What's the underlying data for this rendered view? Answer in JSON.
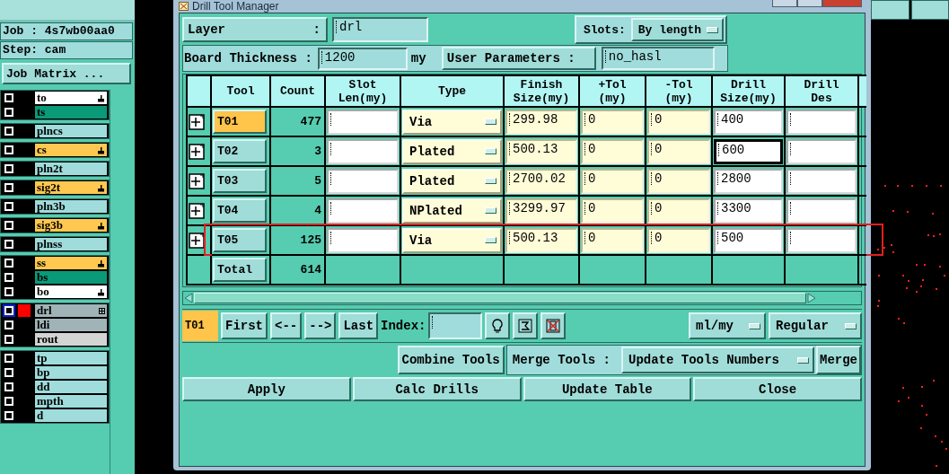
{
  "title_bar": {
    "title": "Drill Tool Manager"
  },
  "job_panel": {
    "job_label": "Job : 4s7wb00aa0",
    "step_label": "Step: cam",
    "matrix_button": "Job Matrix ...",
    "layer_groups": [
      {
        "layers": [
          {
            "name": "to",
            "color": "#ffffff",
            "checked": false,
            "selected": false,
            "hand_mark": true,
            "grid_mark": false
          },
          {
            "name": "ts",
            "color": "#0a9a78",
            "checked": false,
            "selected": false,
            "hand_mark": false,
            "grid_mark": false
          }
        ]
      },
      {
        "layers": [
          {
            "name": "plncs",
            "color": "#a0dcdc",
            "checked": false,
            "selected": false,
            "hand_mark": false,
            "grid_mark": false
          }
        ]
      },
      {
        "layers": [
          {
            "name": "cs",
            "color": "#ffc850",
            "checked": false,
            "selected": false,
            "hand_mark": true,
            "grid_mark": false
          }
        ]
      },
      {
        "layers": [
          {
            "name": "pln2t",
            "color": "#a0dcdc",
            "checked": false,
            "selected": false,
            "hand_mark": false,
            "grid_mark": false
          }
        ]
      },
      {
        "layers": [
          {
            "name": "sig2t",
            "color": "#ffc850",
            "checked": false,
            "selected": false,
            "hand_mark": true,
            "grid_mark": false
          }
        ]
      },
      {
        "layers": [
          {
            "name": "pln3b",
            "color": "#a0dcdc",
            "checked": false,
            "selected": false,
            "hand_mark": false,
            "grid_mark": false
          }
        ]
      },
      {
        "layers": [
          {
            "name": "sig3b",
            "color": "#ffc850",
            "checked": false,
            "selected": false,
            "hand_mark": true,
            "grid_mark": false
          }
        ]
      },
      {
        "layers": [
          {
            "name": "plnss",
            "color": "#a0dcdc",
            "checked": false,
            "selected": false,
            "hand_mark": false,
            "grid_mark": false
          }
        ]
      },
      {
        "layers": [
          {
            "name": "ss",
            "color": "#ffc850",
            "checked": false,
            "selected": false,
            "hand_mark": true,
            "grid_mark": false
          },
          {
            "name": "bs",
            "color": "#0a9a78",
            "checked": false,
            "selected": false,
            "hand_mark": false,
            "grid_mark": false
          },
          {
            "name": "bo",
            "color": "#ffffff",
            "checked": false,
            "selected": false,
            "hand_mark": true,
            "grid_mark": false
          }
        ]
      },
      {
        "layers": [
          {
            "name": "drl",
            "color": "#a0b4b8",
            "checked": false,
            "selected": true,
            "swatch": {
              "color": "#ff0000"
            },
            "hand_mark": false,
            "grid_mark": true
          },
          {
            "name": "ldi",
            "color": "#a0b4b8",
            "checked": false,
            "selected": false,
            "hand_mark": false,
            "grid_mark": false
          },
          {
            "name": "rout",
            "color": "#d4d4d4",
            "checked": false,
            "selected": false,
            "hand_mark": false,
            "grid_mark": false
          }
        ]
      },
      {
        "layers": [
          {
            "name": "tp",
            "color": "#a0dcdc",
            "checked": false,
            "selected": false,
            "hand_mark": false,
            "grid_mark": false
          },
          {
            "name": "bp",
            "color": "#a0dcdc",
            "checked": false,
            "selected": false,
            "hand_mark": false,
            "grid_mark": false
          },
          {
            "name": "dd",
            "color": "#a0dcdc",
            "checked": false,
            "selected": false,
            "hand_mark": false,
            "grid_mark": false
          },
          {
            "name": "mpth",
            "color": "#a0dcdc",
            "checked": false,
            "selected": false,
            "hand_mark": false,
            "grid_mark": false
          },
          {
            "name": "d",
            "color": "#a0dcdc",
            "checked": false,
            "selected": false,
            "hand_mark": false,
            "grid_mark": false
          }
        ]
      }
    ]
  },
  "layer": {
    "label": "Layer",
    "colon": ":",
    "value": "drl"
  },
  "slots": {
    "label": "Slots:",
    "value": "By length"
  },
  "board_thickness": {
    "label": "Board Thickness :",
    "value": "1200",
    "unit": "my"
  },
  "user_parameters": {
    "label": "User Parameters :",
    "value": "no_hasl"
  },
  "table": {
    "columns": [
      "Tool",
      "Count",
      "Slot\nLen(my)",
      "Type",
      "Finish\nSize(my)",
      "+Tol\n(my)",
      "-Tol\n(my)",
      "Drill\nSize(my)",
      "Drill\nDes"
    ],
    "rows": [
      {
        "tool": "T01",
        "selected": true,
        "count": "477",
        "type": "Via",
        "finish": "299.98",
        "plus_tol": "0",
        "minus_tol": "0",
        "drill_size": "400",
        "focused": false,
        "highlighted": false
      },
      {
        "tool": "T02",
        "selected": false,
        "count": "3",
        "type": "Plated",
        "finish": "500.13",
        "plus_tol": "0",
        "minus_tol": "0",
        "drill_size": "600",
        "focused": true,
        "highlighted": false
      },
      {
        "tool": "T03",
        "selected": false,
        "count": "5",
        "type": "Plated",
        "finish": "2700.02",
        "plus_tol": "0",
        "minus_tol": "0",
        "drill_size": "2800",
        "focused": false,
        "highlighted": false
      },
      {
        "tool": "T04",
        "selected": false,
        "count": "4",
        "type": "NPlated",
        "finish": "3299.97",
        "plus_tol": "0",
        "minus_tol": "0",
        "drill_size": "3300",
        "focused": false,
        "highlighted": false
      },
      {
        "tool": "T05",
        "selected": false,
        "count": "125",
        "type": "Via",
        "finish": "500.13",
        "plus_tol": "0",
        "minus_tol": "0",
        "drill_size": "500",
        "focused": false,
        "highlighted": true
      }
    ],
    "total": {
      "label": "Total",
      "count": "614"
    }
  },
  "navigation": {
    "current": "T01",
    "buttons": [
      "First",
      "<--",
      "-->",
      "Last"
    ],
    "index_label": "Index:",
    "unit_dropdown": "ml/my",
    "mode_dropdown": "Regular"
  },
  "merge": {
    "combine_button": "Combine Tools",
    "merge_label": "Merge Tools :",
    "merge_mode": "Update Tools Numbers",
    "merge_button": "Merge"
  },
  "actions": [
    "Apply",
    "Calc Drills",
    "Update Table",
    "Close"
  ]
}
